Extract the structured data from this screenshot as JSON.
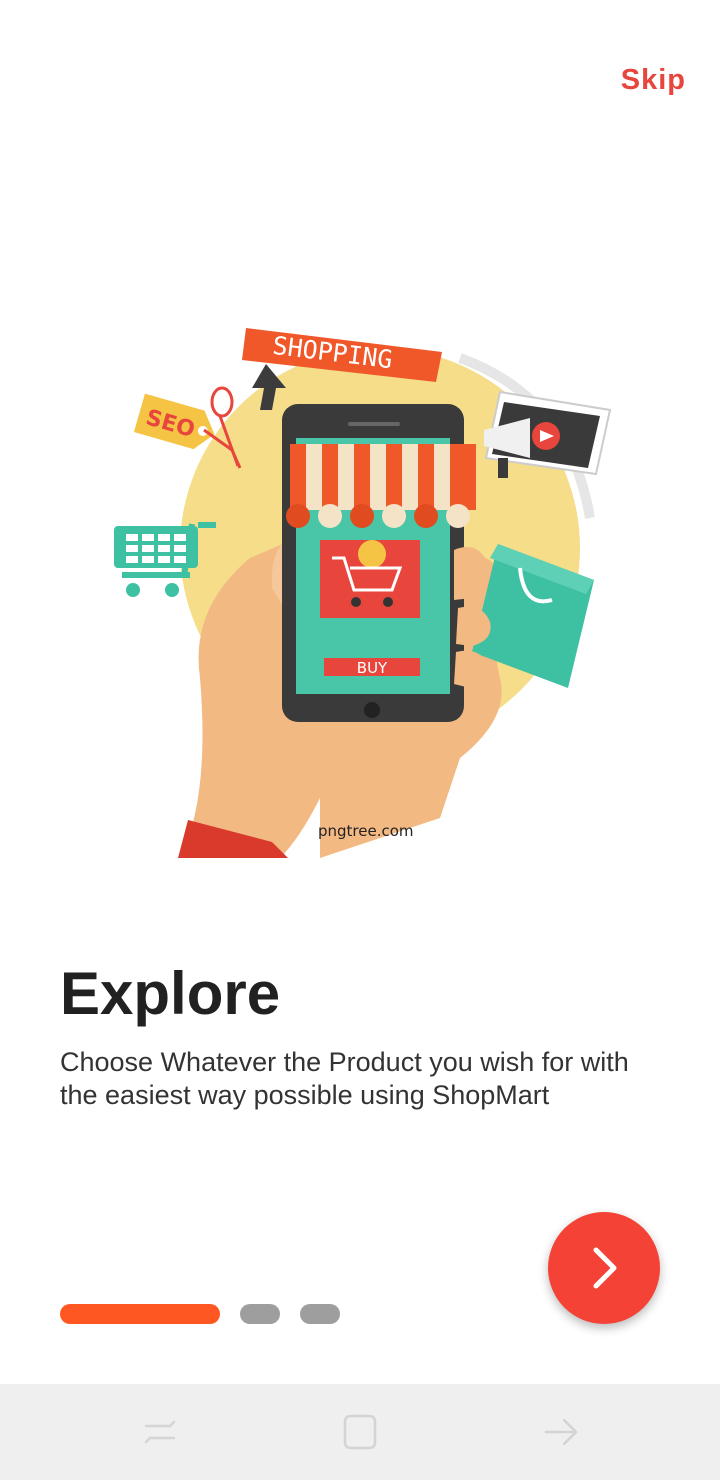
{
  "header": {
    "skip_label": "Skip"
  },
  "illustration": {
    "banner_text": "SHOPPING",
    "tag_text": "SEO",
    "buy_text": "BUY",
    "watermark_text": "pngtree.com"
  },
  "onboarding": {
    "title": "Explore",
    "description": "Choose Whatever the Product you wish for with the easiest way possible using ShopMart",
    "current_page": 1,
    "total_pages": 3,
    "indicator_active_color": "#ff5722",
    "indicator_inactive_color": "#9e9e9e"
  },
  "next_button": {
    "icon": "chevron-right-icon",
    "color": "#f44336"
  },
  "system_nav": {
    "buttons": [
      "recents-icon",
      "home-icon",
      "back-icon"
    ]
  },
  "colors": {
    "accent": "#e8453c"
  }
}
